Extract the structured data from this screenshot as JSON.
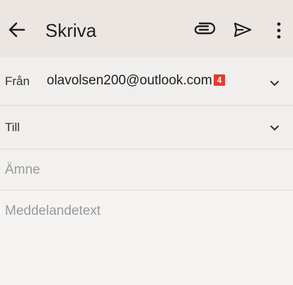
{
  "appbar": {
    "title": "Skriva",
    "icons": [
      "back-arrow-icon",
      "attachment-icon",
      "send-icon",
      "more-vert-icon"
    ]
  },
  "compose": {
    "from_label": "Från",
    "from_value": "olavolsen200@outlook.com",
    "from_badge": "4",
    "to_label": "Till",
    "subject_placeholder": "Ämne",
    "body_placeholder": "Meddelandetext"
  },
  "colors": {
    "appbar_bg": "#ece6e3",
    "badge_bg": "#e43b2e",
    "page_bg": "#f6f4f2"
  }
}
